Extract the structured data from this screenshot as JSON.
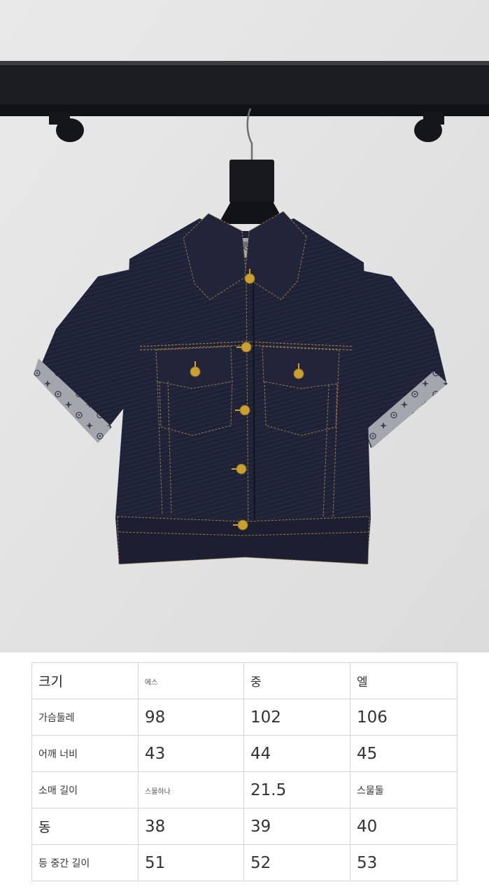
{
  "product_photo": {
    "subject": "jacket",
    "label_text": ""
  },
  "size_table": {
    "header": [
      "크기",
      "에스",
      "중",
      "엘"
    ],
    "rows": [
      {
        "label": "가슴둘레",
        "values": [
          "98",
          "102",
          "106"
        ]
      },
      {
        "label": "어깨 너비",
        "values": [
          "43",
          "44",
          "45"
        ]
      },
      {
        "label": "소매 길이",
        "values": [
          "스물하나",
          "21.5",
          "스물둘"
        ]
      },
      {
        "label": "동",
        "values": [
          "38",
          "39",
          "40"
        ]
      },
      {
        "label": "등 중간 길이",
        "values": [
          "51",
          "52",
          "53"
        ]
      }
    ]
  },
  "colors": {
    "denim": "#1f2236",
    "stitch": "#9a7a45",
    "button_gold": "#c9a032",
    "cuff_gray": "#9da0a7",
    "rail": "#1c1d21",
    "wall": "#e3e3e3"
  }
}
